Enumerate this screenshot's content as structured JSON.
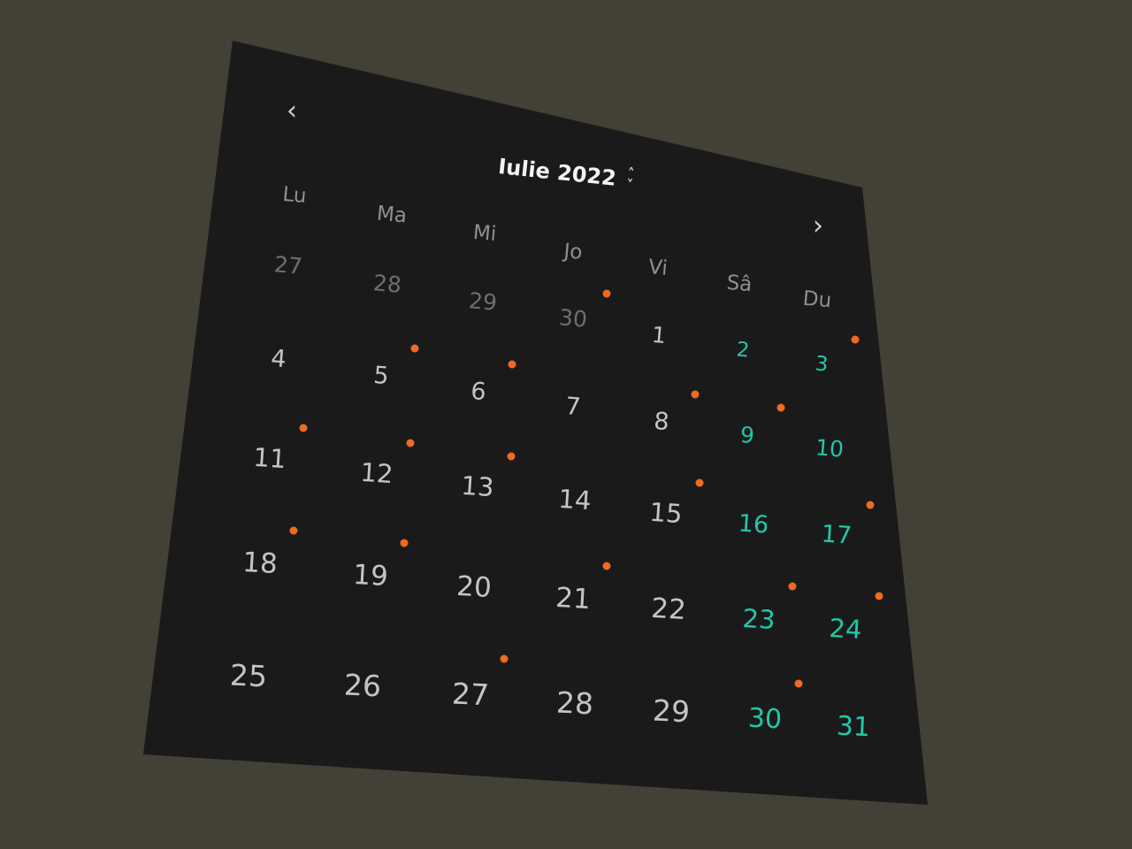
{
  "header": {
    "title": "Iulie 2022",
    "prev_icon": "chevron-left-icon",
    "next_icon": "chevron-right-icon",
    "switch_icon": "chevron-up-down-icon"
  },
  "weekdays": [
    "Lu",
    "Ma",
    "Mi",
    "Jo",
    "Vi",
    "Sâ",
    "Du"
  ],
  "weeks": [
    [
      {
        "label": "27",
        "kind": "other",
        "dot": false
      },
      {
        "label": "28",
        "kind": "other",
        "dot": false
      },
      {
        "label": "29",
        "kind": "other",
        "dot": false
      },
      {
        "label": "30",
        "kind": "other",
        "dot": true
      },
      {
        "label": "1",
        "kind": "cur",
        "dot": false
      },
      {
        "label": "2",
        "kind": "weekend",
        "dot": false
      },
      {
        "label": "3",
        "kind": "weekend",
        "dot": true
      }
    ],
    [
      {
        "label": "4",
        "kind": "cur",
        "dot": false
      },
      {
        "label": "5",
        "kind": "cur",
        "dot": true
      },
      {
        "label": "6",
        "kind": "cur",
        "dot": true
      },
      {
        "label": "7",
        "kind": "cur",
        "dot": false
      },
      {
        "label": "8",
        "kind": "cur",
        "dot": true
      },
      {
        "label": "9",
        "kind": "weekend",
        "dot": true
      },
      {
        "label": "10",
        "kind": "weekend",
        "dot": false
      }
    ],
    [
      {
        "label": "11",
        "kind": "cur",
        "dot": true
      },
      {
        "label": "12",
        "kind": "cur",
        "dot": true
      },
      {
        "label": "13",
        "kind": "cur",
        "dot": true
      },
      {
        "label": "14",
        "kind": "cur",
        "dot": false
      },
      {
        "label": "15",
        "kind": "cur",
        "dot": true
      },
      {
        "label": "16",
        "kind": "weekend",
        "dot": false
      },
      {
        "label": "17",
        "kind": "weekend",
        "dot": true
      }
    ],
    [
      {
        "label": "18",
        "kind": "cur",
        "dot": true
      },
      {
        "label": "19",
        "kind": "cur",
        "dot": true
      },
      {
        "label": "20",
        "kind": "cur",
        "dot": false
      },
      {
        "label": "21",
        "kind": "cur",
        "dot": true
      },
      {
        "label": "22",
        "kind": "cur",
        "dot": false
      },
      {
        "label": "23",
        "kind": "weekend",
        "dot": true
      },
      {
        "label": "24",
        "kind": "weekend",
        "dot": true
      }
    ],
    [
      {
        "label": "25",
        "kind": "cur",
        "dot": false
      },
      {
        "label": "26",
        "kind": "cur",
        "dot": false
      },
      {
        "label": "27",
        "kind": "cur",
        "dot": true
      },
      {
        "label": "28",
        "kind": "cur",
        "dot": false
      },
      {
        "label": "29",
        "kind": "cur",
        "dot": false
      },
      {
        "label": "30",
        "kind": "weekend",
        "dot": true
      },
      {
        "label": "31",
        "kind": "weekend",
        "dot": false
      }
    ]
  ],
  "colors": {
    "background": "#434036",
    "panel": "#1a1a1a",
    "other_month_text": "#6e6e6e",
    "current_month_text": "#c4c4c4",
    "weekend_text": "#21c7a8",
    "event_dot": "#f06a23",
    "title_text": "#f2f2f2"
  }
}
